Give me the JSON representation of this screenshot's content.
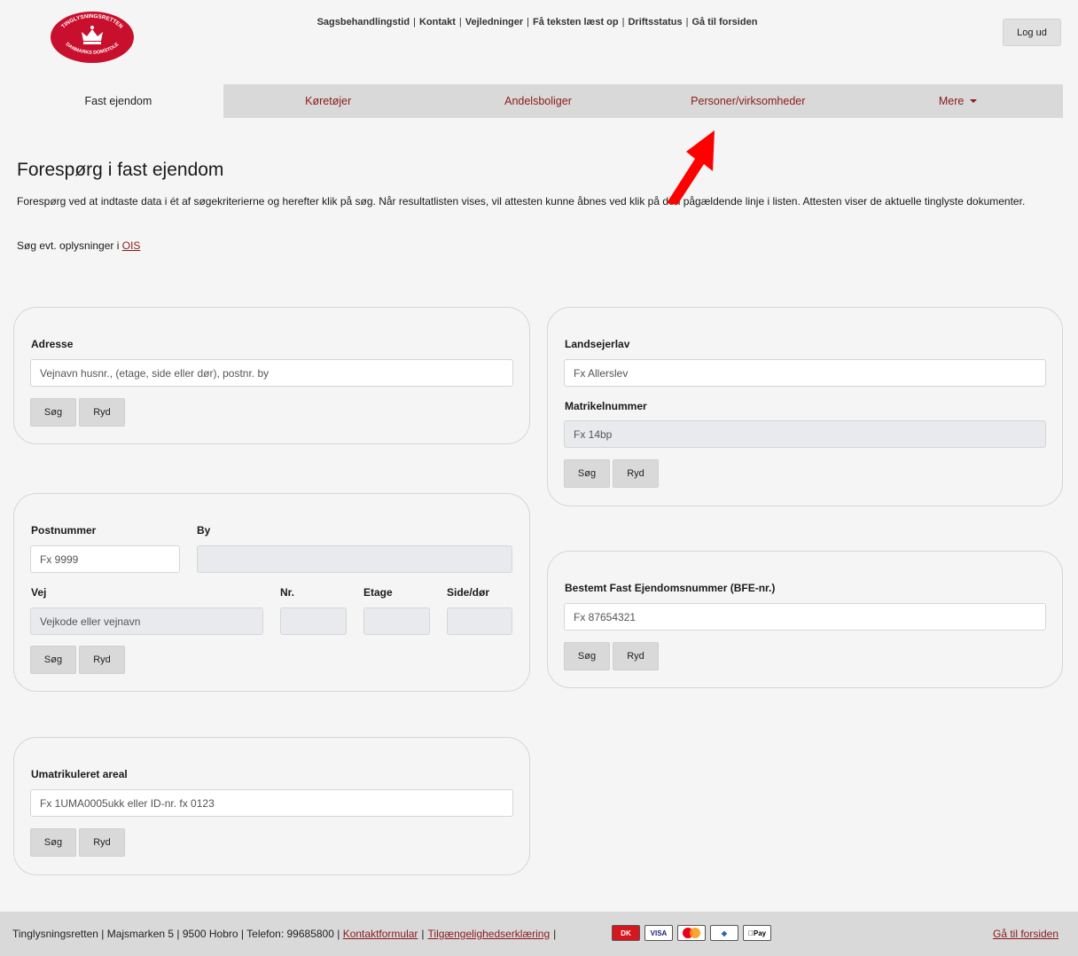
{
  "logo": {
    "top_text": "TINGLYSNINGSRETTEN",
    "bottom_text": "DANMARKS DOMSTOLE",
    "color": "#c8102e"
  },
  "toplinks": [
    "Sagsbehandlingstid",
    "Kontakt",
    "Vejledninger",
    "Få teksten læst op",
    "Driftsstatus",
    "Gå til forsiden"
  ],
  "logout_label": "Log ud",
  "tabs": [
    {
      "label": "Fast ejendom",
      "active": true
    },
    {
      "label": "Køretøjer"
    },
    {
      "label": "Andelsboliger"
    },
    {
      "label": "Personer/virksomheder"
    },
    {
      "label": "Mere"
    }
  ],
  "page": {
    "title": "Forespørg i fast ejendom",
    "intro": "Forespørg ved at indtaste data i ét af søgekriterierne og herefter klik på søg. Når resultatlisten vises, vil attesten kunne åbnes ved klik på den pågældende linje i listen. Attesten viser de aktuelle tinglyste dokumenter.",
    "ois_prefix": "Søg evt. oplysninger i",
    "ois_link": "OIS"
  },
  "buttons": {
    "search": "Søg",
    "clear": "Ryd"
  },
  "address_panel": {
    "label": "Adresse",
    "placeholder": "Vejnavn husnr., (etage, side eller dør), postnr. by"
  },
  "postal_panel": {
    "postnummer_label": "Postnummer",
    "postnummer_placeholder": "Fx 9999",
    "by_label": "By",
    "vej_label": "Vej",
    "vej_placeholder": "Vejkode eller vejnavn",
    "nr_label": "Nr.",
    "etage_label": "Etage",
    "side_label": "Side/dør"
  },
  "umatrikuleret_panel": {
    "label": "Umatrikuleret areal",
    "placeholder": "Fx 1UMA0005ukk eller ID-nr. fx 0123"
  },
  "landsejerlav_panel": {
    "landsejerlav_label": "Landsejerlav",
    "landsejerlav_placeholder": "Fx Allerslev",
    "matrikel_label": "Matrikelnummer",
    "matrikel_placeholder": "Fx 14bp"
  },
  "bfe_panel": {
    "label": "Bestemt Fast Ejendomsnummer (BFE-nr.)",
    "placeholder": "Fx 87654321"
  },
  "footer": {
    "text": "Tinglysningsretten | Majsmarken 5 | 9500 Hobro | Telefon: 99685800 |",
    "links": [
      "Kontaktformular",
      "Tilgængelighedserklæring"
    ],
    "pay_icons": [
      "DK",
      "VISA",
      "MasterCard",
      "MobilePay",
      "Pay"
    ],
    "home_link": "Gå til forsiden"
  },
  "colors": {
    "accent": "#8b1a1a",
    "arrow": "#ff0000"
  }
}
